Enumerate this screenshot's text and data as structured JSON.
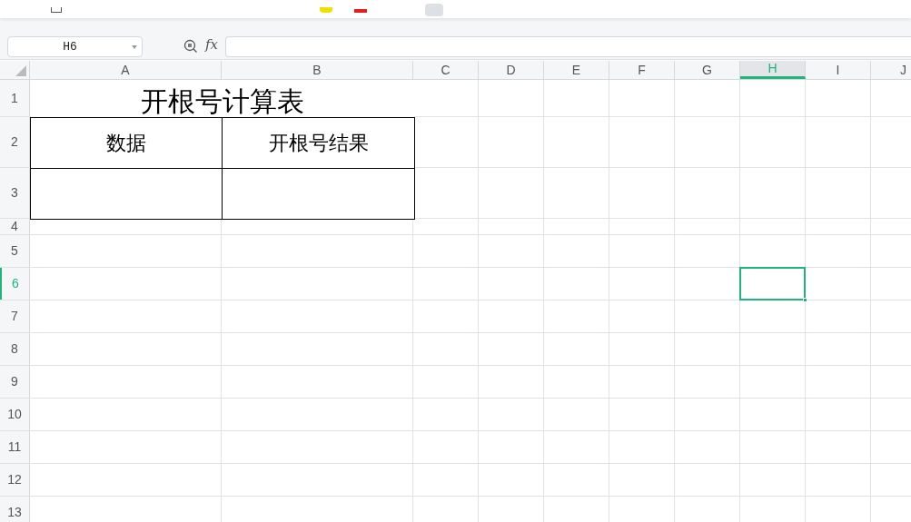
{
  "name_box": {
    "value": "H6"
  },
  "formula_bar": {
    "label": "fx"
  },
  "columns": [
    {
      "label": "A",
      "selected": false
    },
    {
      "label": "B",
      "selected": false
    },
    {
      "label": "C",
      "selected": false
    },
    {
      "label": "D",
      "selected": false
    },
    {
      "label": "E",
      "selected": false
    },
    {
      "label": "F",
      "selected": false
    },
    {
      "label": "G",
      "selected": false
    },
    {
      "label": "H",
      "selected": true
    },
    {
      "label": "I",
      "selected": false
    },
    {
      "label": "J",
      "selected": false
    }
  ],
  "rows": [
    {
      "label": "1",
      "selected": false
    },
    {
      "label": "2",
      "selected": false
    },
    {
      "label": "3",
      "selected": false
    },
    {
      "label": "4",
      "selected": false
    },
    {
      "label": "5",
      "selected": false
    },
    {
      "label": "6",
      "selected": true
    },
    {
      "label": "7",
      "selected": false
    },
    {
      "label": "8",
      "selected": false
    },
    {
      "label": "9",
      "selected": false
    },
    {
      "label": "10",
      "selected": false
    },
    {
      "label": "11",
      "selected": false
    },
    {
      "label": "12",
      "selected": false
    },
    {
      "label": "13",
      "selected": false
    }
  ],
  "sheet": {
    "title": "开根号计算表",
    "table_headers": [
      "数据",
      "开根号结果"
    ]
  }
}
